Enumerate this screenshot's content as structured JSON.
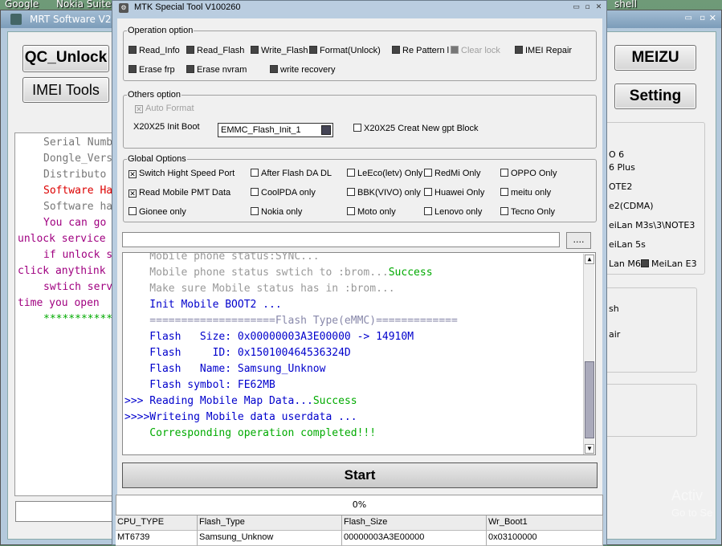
{
  "taskbar": {
    "google": "Google",
    "nokia": "Nokia Suite",
    "shell": "shell"
  },
  "bg": {
    "title": "MRT Software V2.6",
    "qc_unlock": "QC_Unlock",
    "imei_tools": "IMEI Tools",
    "meizu": "MEIZU",
    "setting": "Setting",
    "log": [
      {
        "text": "Serial Numb",
        "color": "#777"
      },
      {
        "text": "Dongle_Vers",
        "color": "#777"
      },
      {
        "text": "Distributo",
        "color": "#777"
      },
      {
        "text": "Software Ha",
        "color": "#d00"
      },
      {
        "text": "Software ha",
        "color": "#777"
      },
      {
        "text": "You can go",
        "color": "#a00080"
      },
      {
        "text": "unlock service",
        "color": "#a00080"
      },
      {
        "text": "if unlock s",
        "color": "#a00080"
      },
      {
        "text": "click anythink",
        "color": "#a00080"
      },
      {
        "text": "swtich serv",
        "color": "#a00080"
      },
      {
        "text": "time you open",
        "color": "#a00080"
      },
      {
        "text": "*************",
        "color": "#0a0"
      }
    ],
    "right": [
      "O 6",
      "6 Plus",
      "OTE2",
      "e2(CDMA)",
      "eiLan M3s\\3\\NOTE3",
      "eiLan 5s",
      "Lan M6",
      "MeiLan E3",
      "sh",
      "air"
    ]
  },
  "main": {
    "title": "MTK Special Tool V100260",
    "operation": {
      "label": "Operation option",
      "items": [
        {
          "label": "Read_Info",
          "checked": false
        },
        {
          "label": "Read_Flash",
          "checked": false
        },
        {
          "label": "Write_Flash",
          "checked": false
        },
        {
          "label": "Format(Unlock)",
          "checked": false
        },
        {
          "label": "Re Pattern l",
          "checked": false
        },
        {
          "label": "Clear lock",
          "checked": false
        },
        {
          "label": "IMEI Repair",
          "checked": false
        },
        {
          "label": "Erase frp",
          "checked": false
        },
        {
          "label": "Erase nvram",
          "checked": false
        },
        {
          "label": "write recovery",
          "checked": false
        }
      ]
    },
    "others": {
      "label": "Others option",
      "auto_format": "Auto Format",
      "init_boot_label": "X20X25 Init Boot",
      "init_boot_value": "EMMC_Flash_Init_1",
      "gpt": "X20X25 Creat New gpt Block"
    },
    "global": {
      "label": "Global Options",
      "items": [
        {
          "label": "Switch Hight Speed Port",
          "checked": true
        },
        {
          "label": "After Flash DA DL",
          "checked": false
        },
        {
          "label": "LeEco(letv) Only",
          "checked": false
        },
        {
          "label": "RedMi Only",
          "checked": false
        },
        {
          "label": "OPPO Only",
          "checked": false
        },
        {
          "label": "Read Mobile PMT Data",
          "checked": true
        },
        {
          "label": "CoolPDA only",
          "checked": false
        },
        {
          "label": "BBK(VIVO) only",
          "checked": false
        },
        {
          "label": "Huawei Only",
          "checked": false
        },
        {
          "label": "meitu only",
          "checked": false
        },
        {
          "label": "Gionee only",
          "checked": false
        },
        {
          "label": "Nokia only",
          "checked": false
        },
        {
          "label": "Moto only",
          "checked": false
        },
        {
          "label": "Lenovo only",
          "checked": false
        },
        {
          "label": "Tecno Only",
          "checked": false
        }
      ]
    },
    "browse": "....",
    "log": [
      {
        "pre": "    Mobile phone status:SYNC...",
        "suc": "",
        "color": "#999"
      },
      {
        "pre": "    Mobile phone status swtich to :brom...",
        "suc": "Success",
        "color": "#999"
      },
      {
        "pre": "    Make sure Mobile status has in :brom...",
        "suc": "",
        "color": "#999"
      },
      {
        "pre": "    Init Mobile BOOT2 ...",
        "suc": "",
        "color": "#00c"
      },
      {
        "pre": "    ====================Flash Type(eMMC)=============",
        "suc": "",
        "color": "#88a"
      },
      {
        "pre": "    Flash   Size: 0x00000003A3E00000 -> 14910M",
        "suc": "",
        "color": "#00c"
      },
      {
        "pre": "    Flash     ID: 0x150100464536324D",
        "suc": "",
        "color": "#00c"
      },
      {
        "pre": "    Flash   Name: Samsung_Unknow",
        "suc": "",
        "color": "#00c"
      },
      {
        "pre": "    Flash symbol: FE62MB",
        "suc": "",
        "color": "#00c"
      },
      {
        "pre": ">>> Reading Mobile Map Data...",
        "suc": "Success",
        "color": "#00c"
      },
      {
        "pre": ">>>>Writeing Mobile data userdata ...",
        "suc": "",
        "color": "#00c"
      },
      {
        "pre": "    Corresponding operation completed!!!",
        "suc": "",
        "color": "#0a0"
      }
    ],
    "start": "Start",
    "progress": "0%",
    "progress_value": 0,
    "table": {
      "headers": [
        "CPU_TYPE",
        "Flash_Type",
        "Flash_Size",
        "Wr_Boot1"
      ],
      "row": [
        "MT6739",
        "Samsung_Unknow",
        "00000003A3E00000",
        "0x03100000"
      ]
    }
  },
  "watermark": {
    "line1": "Activ",
    "line2": "Go to Se"
  }
}
